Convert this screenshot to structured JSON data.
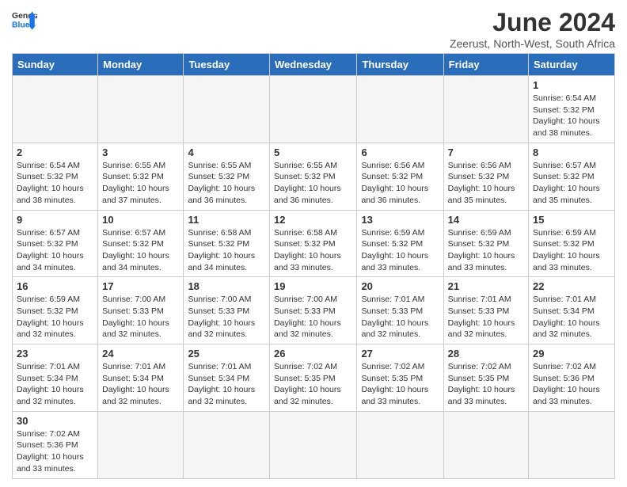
{
  "header": {
    "logo_general": "General",
    "logo_blue": "Blue",
    "title": "June 2024",
    "subtitle": "Zeerust, North-West, South Africa"
  },
  "weekdays": [
    "Sunday",
    "Monday",
    "Tuesday",
    "Wednesday",
    "Thursday",
    "Friday",
    "Saturday"
  ],
  "weeks": [
    [
      {
        "day": "",
        "info": ""
      },
      {
        "day": "",
        "info": ""
      },
      {
        "day": "",
        "info": ""
      },
      {
        "day": "",
        "info": ""
      },
      {
        "day": "",
        "info": ""
      },
      {
        "day": "",
        "info": ""
      },
      {
        "day": "1",
        "info": "Sunrise: 6:54 AM\nSunset: 5:32 PM\nDaylight: 10 hours and 38 minutes."
      }
    ],
    [
      {
        "day": "2",
        "info": "Sunrise: 6:54 AM\nSunset: 5:32 PM\nDaylight: 10 hours and 38 minutes."
      },
      {
        "day": "3",
        "info": "Sunrise: 6:55 AM\nSunset: 5:32 PM\nDaylight: 10 hours and 37 minutes."
      },
      {
        "day": "4",
        "info": "Sunrise: 6:55 AM\nSunset: 5:32 PM\nDaylight: 10 hours and 36 minutes."
      },
      {
        "day": "5",
        "info": "Sunrise: 6:55 AM\nSunset: 5:32 PM\nDaylight: 10 hours and 36 minutes."
      },
      {
        "day": "6",
        "info": "Sunrise: 6:56 AM\nSunset: 5:32 PM\nDaylight: 10 hours and 36 minutes."
      },
      {
        "day": "7",
        "info": "Sunrise: 6:56 AM\nSunset: 5:32 PM\nDaylight: 10 hours and 35 minutes."
      },
      {
        "day": "8",
        "info": "Sunrise: 6:57 AM\nSunset: 5:32 PM\nDaylight: 10 hours and 35 minutes."
      }
    ],
    [
      {
        "day": "9",
        "info": "Sunrise: 6:57 AM\nSunset: 5:32 PM\nDaylight: 10 hours and 34 minutes."
      },
      {
        "day": "10",
        "info": "Sunrise: 6:57 AM\nSunset: 5:32 PM\nDaylight: 10 hours and 34 minutes."
      },
      {
        "day": "11",
        "info": "Sunrise: 6:58 AM\nSunset: 5:32 PM\nDaylight: 10 hours and 34 minutes."
      },
      {
        "day": "12",
        "info": "Sunrise: 6:58 AM\nSunset: 5:32 PM\nDaylight: 10 hours and 33 minutes."
      },
      {
        "day": "13",
        "info": "Sunrise: 6:59 AM\nSunset: 5:32 PM\nDaylight: 10 hours and 33 minutes."
      },
      {
        "day": "14",
        "info": "Sunrise: 6:59 AM\nSunset: 5:32 PM\nDaylight: 10 hours and 33 minutes."
      },
      {
        "day": "15",
        "info": "Sunrise: 6:59 AM\nSunset: 5:32 PM\nDaylight: 10 hours and 33 minutes."
      }
    ],
    [
      {
        "day": "16",
        "info": "Sunrise: 6:59 AM\nSunset: 5:32 PM\nDaylight: 10 hours and 32 minutes."
      },
      {
        "day": "17",
        "info": "Sunrise: 7:00 AM\nSunset: 5:33 PM\nDaylight: 10 hours and 32 minutes."
      },
      {
        "day": "18",
        "info": "Sunrise: 7:00 AM\nSunset: 5:33 PM\nDaylight: 10 hours and 32 minutes."
      },
      {
        "day": "19",
        "info": "Sunrise: 7:00 AM\nSunset: 5:33 PM\nDaylight: 10 hours and 32 minutes."
      },
      {
        "day": "20",
        "info": "Sunrise: 7:01 AM\nSunset: 5:33 PM\nDaylight: 10 hours and 32 minutes."
      },
      {
        "day": "21",
        "info": "Sunrise: 7:01 AM\nSunset: 5:33 PM\nDaylight: 10 hours and 32 minutes."
      },
      {
        "day": "22",
        "info": "Sunrise: 7:01 AM\nSunset: 5:34 PM\nDaylight: 10 hours and 32 minutes."
      }
    ],
    [
      {
        "day": "23",
        "info": "Sunrise: 7:01 AM\nSunset: 5:34 PM\nDaylight: 10 hours and 32 minutes."
      },
      {
        "day": "24",
        "info": "Sunrise: 7:01 AM\nSunset: 5:34 PM\nDaylight: 10 hours and 32 minutes."
      },
      {
        "day": "25",
        "info": "Sunrise: 7:01 AM\nSunset: 5:34 PM\nDaylight: 10 hours and 32 minutes."
      },
      {
        "day": "26",
        "info": "Sunrise: 7:02 AM\nSunset: 5:35 PM\nDaylight: 10 hours and 32 minutes."
      },
      {
        "day": "27",
        "info": "Sunrise: 7:02 AM\nSunset: 5:35 PM\nDaylight: 10 hours and 33 minutes."
      },
      {
        "day": "28",
        "info": "Sunrise: 7:02 AM\nSunset: 5:35 PM\nDaylight: 10 hours and 33 minutes."
      },
      {
        "day": "29",
        "info": "Sunrise: 7:02 AM\nSunset: 5:36 PM\nDaylight: 10 hours and 33 minutes."
      }
    ],
    [
      {
        "day": "30",
        "info": "Sunrise: 7:02 AM\nSunset: 5:36 PM\nDaylight: 10 hours and 33 minutes."
      },
      {
        "day": "",
        "info": ""
      },
      {
        "day": "",
        "info": ""
      },
      {
        "day": "",
        "info": ""
      },
      {
        "day": "",
        "info": ""
      },
      {
        "day": "",
        "info": ""
      },
      {
        "day": "",
        "info": ""
      }
    ]
  ]
}
